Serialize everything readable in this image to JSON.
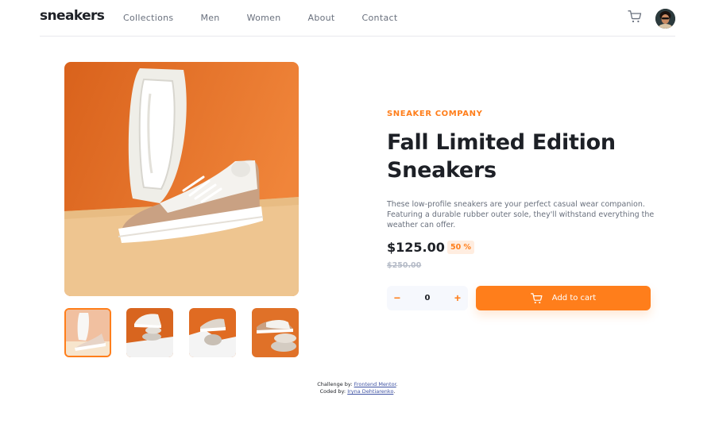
{
  "header": {
    "logo": "sneakers",
    "nav": [
      "Collections",
      "Men",
      "Women",
      "About",
      "Contact"
    ],
    "icons": {
      "cart": "cart-icon",
      "avatar": "avatar"
    }
  },
  "gallery": {
    "thumbnails_count": 4,
    "active_thumbnail": 1
  },
  "product": {
    "company": "SNEAKER COMPANY",
    "title": "Fall Limited Edition Sneakers",
    "description": "These low-profile sneakers are your perfect casual wear companion. Featuring a durable rubber outer sole, they'll withstand everything the weather can offer.",
    "price": "$125.00",
    "discount": "50 %",
    "old_price": "$250.00",
    "quantity": "0",
    "minus_label": "−",
    "plus_label": "+",
    "add_to_cart": "Add to cart"
  },
  "attribution": {
    "challenge_prefix": "Challenge by:",
    "challenge_link": "Frontend Mentor",
    "coded_prefix": "Coded by:",
    "coded_link": "Iryna Dehtiarenko"
  },
  "colors": {
    "accent": "#ff7e1b",
    "accent_pale": "#ffede0",
    "text_dark": "#1d2026",
    "text_gray": "#69707d",
    "text_light": "#b6bcc8"
  }
}
